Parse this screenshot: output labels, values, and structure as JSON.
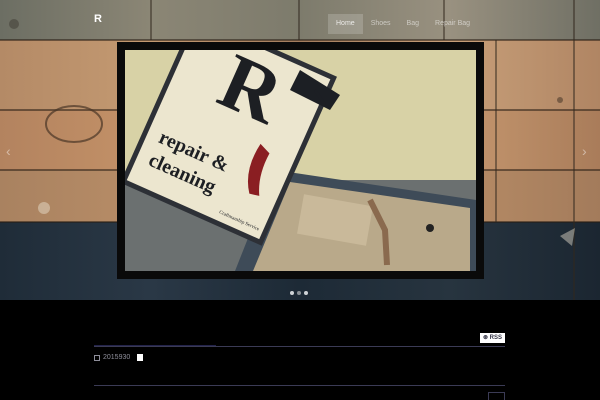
{
  "site": {
    "logo": "R"
  },
  "nav": {
    "items": [
      "Home",
      "Shoes",
      "Bag",
      "Repair Bag"
    ]
  },
  "slider": {
    "sign_letter": "R",
    "sign_line1": "repair &",
    "sign_line2": "cleaning",
    "sign_small": "Craftmanship Service",
    "prev_arrow": "‹",
    "next_arrow": "›",
    "dots": 3,
    "active_dot": 1
  },
  "content": {
    "rss_label": "RSS",
    "date": "2015930"
  },
  "icons": {
    "calendar": "calendar-icon",
    "rss": "rss-icon",
    "prev": "chevron-left-icon",
    "next": "chevron-right-icon"
  }
}
